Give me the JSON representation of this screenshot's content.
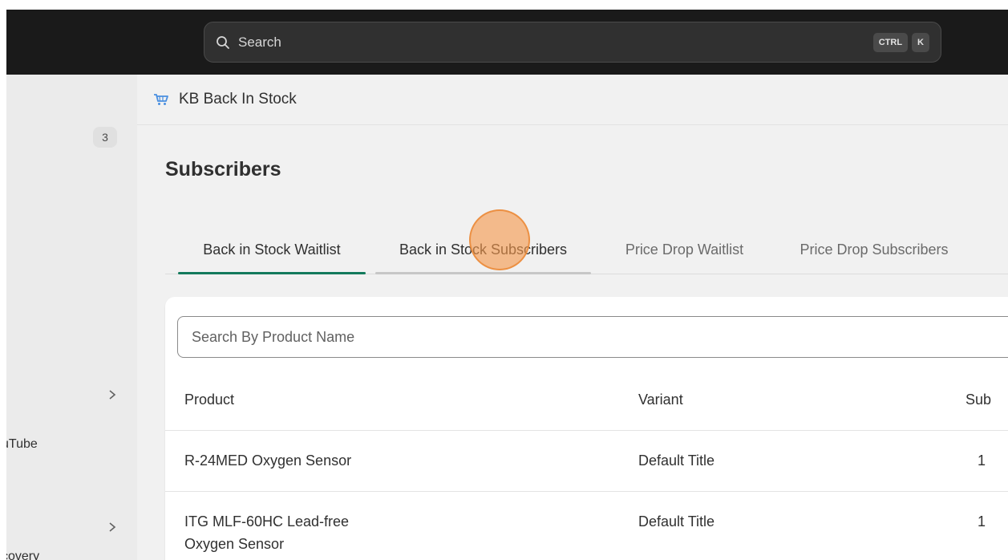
{
  "topbar": {
    "search_placeholder": "Search",
    "shortcut_keys": [
      "CTRL",
      "K"
    ]
  },
  "sidebar": {
    "badge_count": "3",
    "truncated_items": [
      "uTube",
      "covery"
    ]
  },
  "app": {
    "name": "KB Back In Stock",
    "icon": "shopping-cart-icon"
  },
  "page": {
    "title": "Subscribers"
  },
  "tabs": [
    {
      "label": "Back in Stock Waitlist",
      "state": "active"
    },
    {
      "label": "Back in Stock Subscribers",
      "state": "hover"
    },
    {
      "label": "Price Drop Waitlist",
      "state": "normal"
    },
    {
      "label": "Price Drop Subscribers",
      "state": "normal"
    }
  ],
  "table": {
    "search_placeholder": "Search By Product Name",
    "columns": [
      "Product",
      "Variant",
      "Sub"
    ],
    "rows": [
      {
        "product_lines": [
          "R-24MED Oxygen Sensor"
        ],
        "variant": "Default Title",
        "count": "1"
      },
      {
        "product_lines": [
          "ITG MLF-60HC Lead-free",
          "Oxygen Sensor"
        ],
        "variant": "Default Title",
        "count": "1"
      }
    ]
  },
  "colors": {
    "topbar_bg": "#1a1a1a",
    "active_tab_underline": "#137a5c",
    "app_icon": "#4a8fe0",
    "click_indicator": "#f4984c"
  }
}
